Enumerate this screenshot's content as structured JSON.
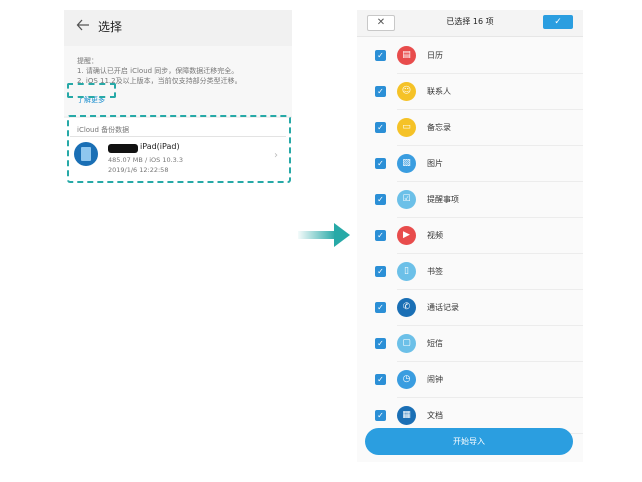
{
  "left_screen": {
    "title": "选择",
    "hint_label": "提醒：",
    "hint_lines": [
      "1. 请确认已开启 iCloud 同步，保障数据迁移完全。",
      "2. iOS 11.2及以上版本，当前仅支持部分类型迁移。"
    ],
    "learn_more": "了解更多",
    "backup_header": "iCloud 备份数据",
    "device": {
      "name": "iPad(iPad)",
      "meta_size": "485.07 MB / iOS 10.3.3",
      "meta_date": "2019/1/6 12:22:58"
    }
  },
  "right_screen": {
    "close_label": "✕",
    "selected_title": "已选择 16 项",
    "confirm_label": "✓",
    "items": [
      {
        "label": "日历",
        "icon": "calendar-icon",
        "color": "#e84c4c",
        "glyph": "▤"
      },
      {
        "label": "联系人",
        "icon": "contacts-icon",
        "color": "#f5c227",
        "glyph": "☺"
      },
      {
        "label": "备忘录",
        "icon": "notes-icon",
        "color": "#f5c227",
        "glyph": "▭"
      },
      {
        "label": "图片",
        "icon": "gallery-icon",
        "color": "#3a9de0",
        "glyph": "▧"
      },
      {
        "label": "提醒事项",
        "icon": "reminders-icon",
        "color": "#6cc0e8",
        "glyph": "☑"
      },
      {
        "label": "视频",
        "icon": "video-icon",
        "color": "#e84c4c",
        "glyph": "▶"
      },
      {
        "label": "书签",
        "icon": "bookmark-icon",
        "color": "#6cc0e8",
        "glyph": "▯"
      },
      {
        "label": "通话记录",
        "icon": "call-log-icon",
        "color": "#1a6fb5",
        "glyph": "✆"
      },
      {
        "label": "短信",
        "icon": "messages-icon",
        "color": "#6cc0e8",
        "glyph": "▢"
      },
      {
        "label": "闹钟",
        "icon": "alarm-icon",
        "color": "#3a9de0",
        "glyph": "◷"
      },
      {
        "label": "文档",
        "icon": "documents-icon",
        "color": "#1a6fb5",
        "glyph": "▦"
      }
    ],
    "start_label": "开始导入"
  },
  "colors": {
    "accent": "#2b9ee0",
    "dash_highlight": "#27a9a7"
  }
}
